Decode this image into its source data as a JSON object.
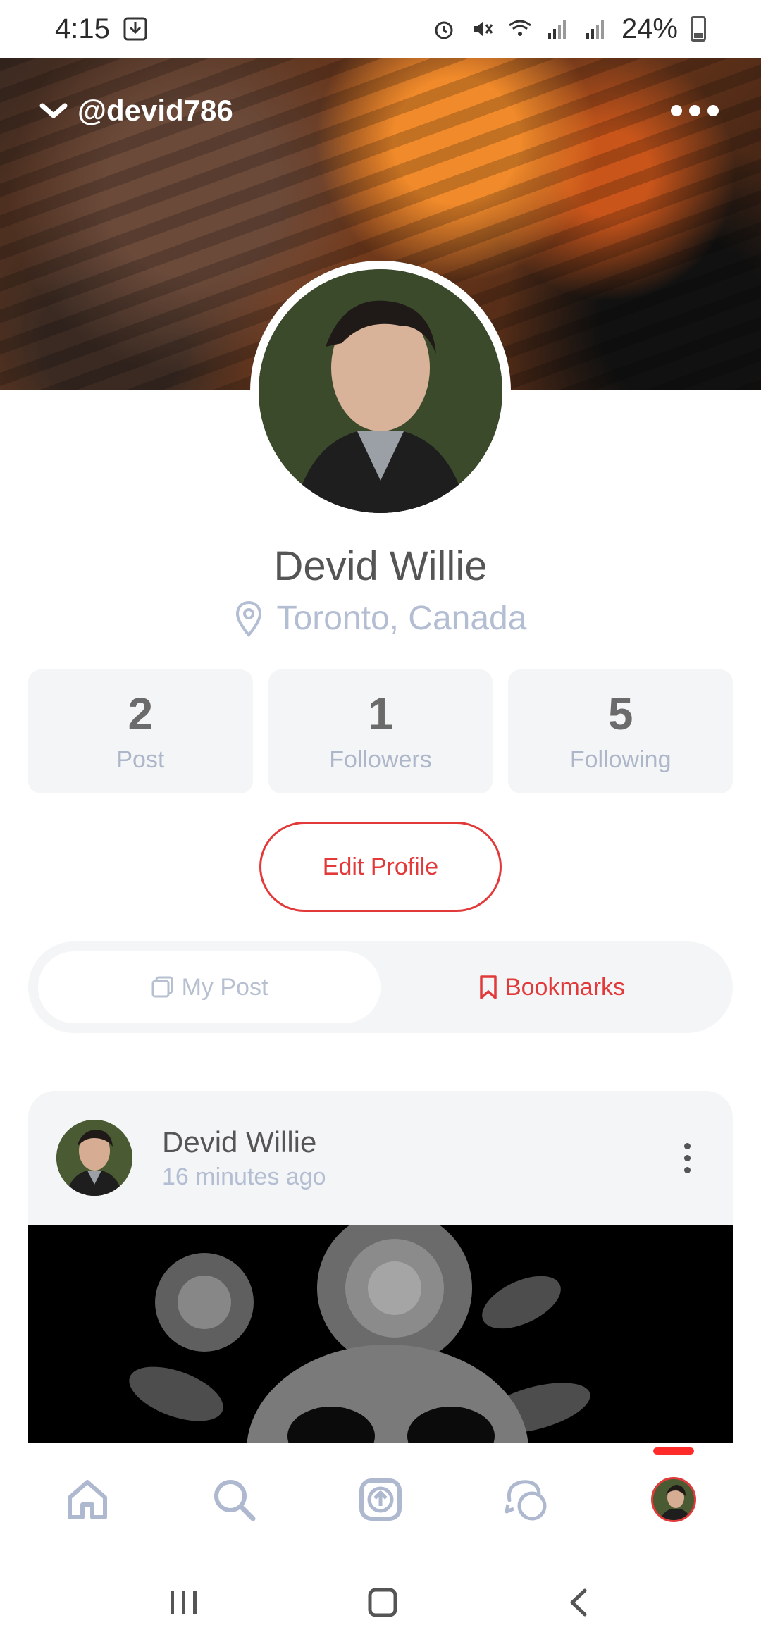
{
  "status_bar": {
    "time": "4:15",
    "battery": "24%"
  },
  "profile": {
    "handle": "@devid786",
    "name": "Devid Willie",
    "location": "Toronto, Canada",
    "stats": [
      {
        "value": "2",
        "label": "Post"
      },
      {
        "value": "1",
        "label": "Followers"
      },
      {
        "value": "5",
        "label": "Following"
      }
    ],
    "edit_label": "Edit Profile"
  },
  "tabs": [
    {
      "label": "My Post",
      "active": true
    },
    {
      "label": "Bookmarks",
      "active": false
    }
  ],
  "post": {
    "author": "Devid Willie",
    "time": "16 minutes ago"
  },
  "bottom_nav": [
    "home-icon",
    "search-icon",
    "upload-icon",
    "chat-icon",
    "profile-avatar"
  ],
  "colors": {
    "accent": "#e23a3a",
    "muted": "#b4bed3",
    "card_bg": "#f4f5f7",
    "indicator": "#ff2b2b"
  }
}
